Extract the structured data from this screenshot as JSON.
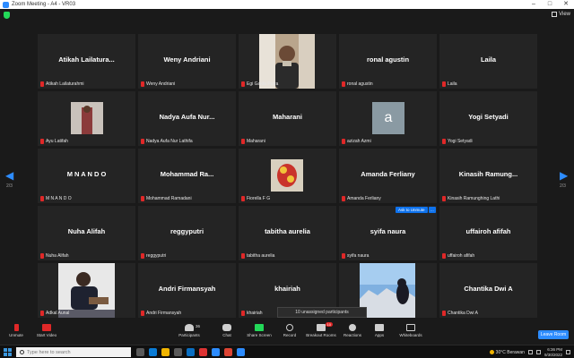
{
  "window": {
    "title": "Zoom Meeting - A4 - VR03"
  },
  "header": {
    "view_label": "View"
  },
  "nav": {
    "left_page": "2/3",
    "right_page": "2/3"
  },
  "tiles": [
    {
      "name": "Atikah  Lailatura...",
      "footer": "Atikah Lailaturahmi"
    },
    {
      "name": "Weny Andriani",
      "footer": "Weny Andriani"
    },
    {
      "name": "",
      "footer": "Egi Gaida Putra"
    },
    {
      "name": "ronal agustin",
      "footer": "ronal agustin"
    },
    {
      "name": "Laila",
      "footer": "Laila"
    },
    {
      "name": "",
      "footer": "Ayu Latifah"
    },
    {
      "name": "Nadya  Aufa  Nur...",
      "footer": "Nadya Aufa Nur Lathifa"
    },
    {
      "name": "Maharani",
      "footer": "Maharani"
    },
    {
      "name": "",
      "footer": "azizah Azmi",
      "avatar_letter": "a"
    },
    {
      "name": "Yogi Setyadi",
      "footer": "Yogi Setyadi"
    },
    {
      "name": "M   N A N D O",
      "footer": "M   N A N D O"
    },
    {
      "name": "Mohammad   Ra...",
      "footer": "Mohammad Ramadani"
    },
    {
      "name": "",
      "footer": "Fiorella F G"
    },
    {
      "name": "Amanda Ferliany",
      "footer": "Amanda Ferliany"
    },
    {
      "name": "Kinasih   Ramung...",
      "footer": "Kinasih Ramunghing Lathi"
    },
    {
      "name": "Nuha Alifah",
      "footer": "Nuha Alifah"
    },
    {
      "name": "reggyputri",
      "footer": "reggyputri"
    },
    {
      "name": "tabitha aurelia",
      "footer": "tabitha aurelia"
    },
    {
      "name": "syifa naura",
      "footer": "syifa naura"
    },
    {
      "name": "uffairoh afifah",
      "footer": "uffairoh afifah"
    },
    {
      "name": "",
      "footer": "Adkal Aunal"
    },
    {
      "name": "Andri Firmansyah",
      "footer": "Andri Firmansyah"
    },
    {
      "name": "khairiah",
      "footer": "khairiah"
    },
    {
      "name": "",
      "footer": ""
    },
    {
      "name": "Chantika Dwi A",
      "footer": "Chantika Dwi A"
    }
  ],
  "ask_to_unmute": {
    "label": "Ask to Unmute",
    "more": "..."
  },
  "unassigned": "10 unassigned participants",
  "toolbar": {
    "unmute": "Unmute",
    "start_video": "Start Video",
    "participants": "Participants",
    "participants_count": "36",
    "chat": "Chat",
    "share_screen": "Share Screen",
    "record": "Record",
    "breakout_rooms": "Breakout Rooms",
    "breakout_badge": "10",
    "reactions": "Reactions",
    "apps": "Apps",
    "whiteboards": "Whiteboards",
    "leave_room": "Leave Room"
  },
  "taskbar": {
    "search_placeholder": "Type here to search",
    "weather": "30°C  Berawan",
    "time": "6:36 PM",
    "date": "9/30/2022"
  },
  "colors": {
    "accent": "#2d8cff",
    "muted_mic": "#e02828",
    "tile_bg": "#242424",
    "share_green": "#23d959"
  }
}
